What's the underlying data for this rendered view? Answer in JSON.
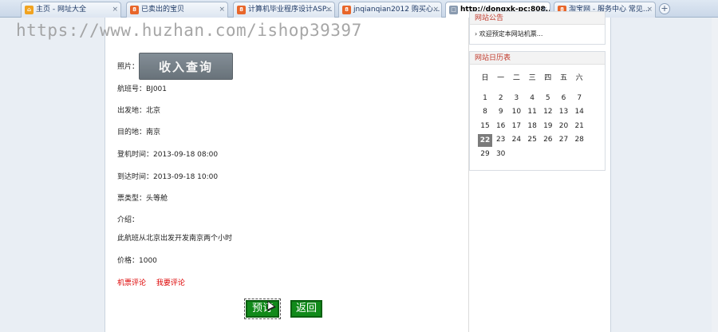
{
  "tabs": [
    {
      "label": "主页 - 网址大全",
      "icon_color": "#f1a320",
      "icon": "home-icon"
    },
    {
      "label": "已卖出的宝贝",
      "icon_color": "#e8662a",
      "icon": "site-icon"
    },
    {
      "label": "计算机毕业程序设计ASP...",
      "icon_color": "#e8662a",
      "icon": "site-icon"
    },
    {
      "label": "jnqianqian2012 购买心...",
      "icon_color": "#e8662a",
      "icon": "site-icon"
    },
    {
      "label": "http://dongxk-pc:808...",
      "icon_color": "#8a9bb0",
      "icon": "page-icon"
    },
    {
      "label": "淘宝网 - 服务中心 常见...",
      "icon_color": "#e8662a",
      "icon": "site-icon"
    }
  ],
  "new_tab": "+",
  "watermark": "https://www.huzhan.com/ishop39397",
  "income_query": "收入查询",
  "flight": {
    "photo": "照片：",
    "flight_no": "航班号：BJ001",
    "from": "出发地：北京",
    "to": "目的地：南京",
    "depart_time": "登机时间：2013-09-18 08:00",
    "arrive_time": "到达时间：2013-09-18 10:00",
    "ticket_type": "票类型：头等舱",
    "intro_label": "介绍：",
    "intro_text": "此航班从北京出发开发南京两个小时",
    "price": "价格：1000"
  },
  "links": {
    "comments": "机票评论",
    "my_comment": "我要评论"
  },
  "buttons": {
    "book": "预订",
    "back": "返回"
  },
  "sidebar": {
    "notice_title": "网站公告",
    "notice_text": "欢迎预定本网站机票...",
    "calendar_title": "网站日历表",
    "weekdays": [
      "日",
      "一",
      "二",
      "三",
      "四",
      "五",
      "六"
    ],
    "weeks": [
      [
        "1",
        "2",
        "3",
        "4",
        "5",
        "6",
        "7"
      ],
      [
        "8",
        "9",
        "10",
        "11",
        "12",
        "13",
        "14"
      ],
      [
        "15",
        "16",
        "17",
        "18",
        "19",
        "20",
        "21"
      ],
      [
        "22",
        "23",
        "24",
        "25",
        "26",
        "27",
        "28"
      ],
      [
        "29",
        "30",
        "",
        "",
        "",
        "",
        ""
      ]
    ],
    "today": "22"
  }
}
